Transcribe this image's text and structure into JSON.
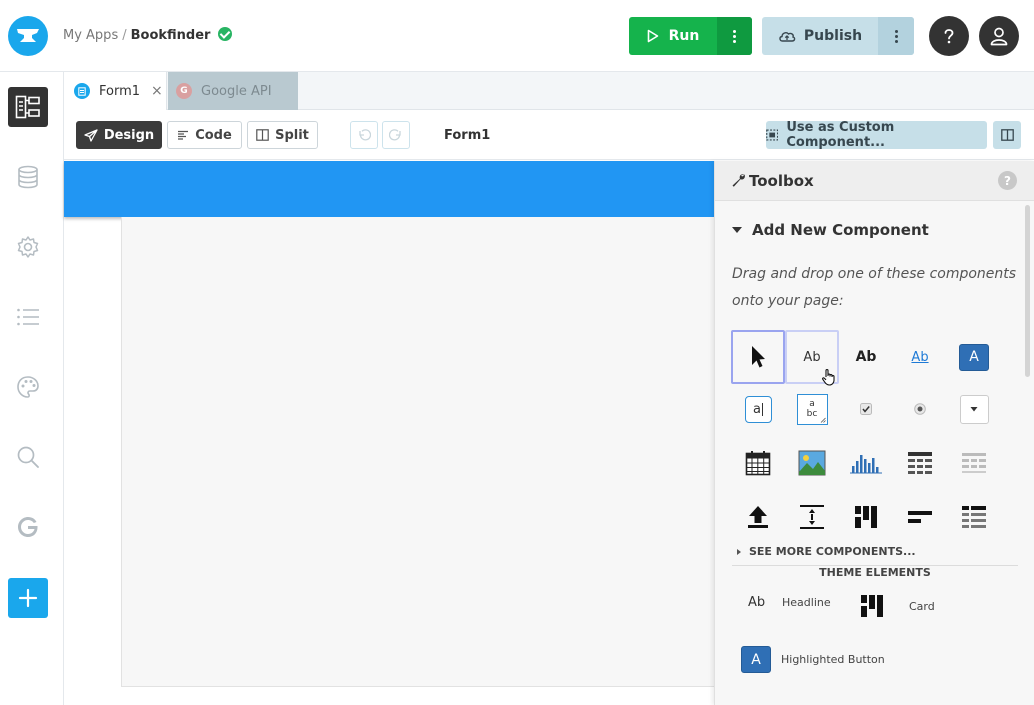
{
  "header": {
    "breadcrumb_root": "My Apps",
    "breadcrumb_sep": "/",
    "app_name": "Bookfinder",
    "run_label": "Run",
    "publish_label": "Publish"
  },
  "sidebar": {
    "items": [
      {
        "name": "app-structure-icon",
        "active": true
      },
      {
        "name": "database-icon"
      },
      {
        "name": "gear-icon"
      },
      {
        "name": "list-icon"
      },
      {
        "name": "palette-icon"
      },
      {
        "name": "search-icon"
      },
      {
        "name": "google-icon"
      },
      {
        "name": "plus-icon"
      }
    ]
  },
  "tabs": [
    {
      "label": "Form1",
      "active": true,
      "close": "×"
    },
    {
      "label": "Google API",
      "active": false
    }
  ],
  "editor": {
    "design_label": "Design",
    "code_label": "Code",
    "split_label": "Split",
    "form_name": "Form1",
    "custom_component_label": "Use as Custom Component..."
  },
  "toolbox": {
    "title": "Toolbox",
    "help": "?",
    "add_new_title": "Add New Component",
    "hint": "Drag and drop one of these components onto your page:",
    "components_text": {
      "label": "Ab",
      "rich_text": "Ab",
      "link": "Ab",
      "button": "A",
      "textbox": "a",
      "textarea_top": "a",
      "textarea_bottom": "bc"
    },
    "see_more": "SEE MORE COMPONENTS...",
    "theme_title": "THEME ELEMENTS",
    "theme_items": {
      "headline_icon_text": "Ab",
      "headline": "Headline",
      "card": "Card",
      "highlighted_icon_text": "A",
      "highlighted_button": "Highlighted Button"
    }
  },
  "colors": {
    "brand_blue": "#1aa7ec",
    "run_green": "#15b34c",
    "publish_bg": "#c6dfe8",
    "form_header": "#2196f3",
    "dark": "#333333"
  }
}
